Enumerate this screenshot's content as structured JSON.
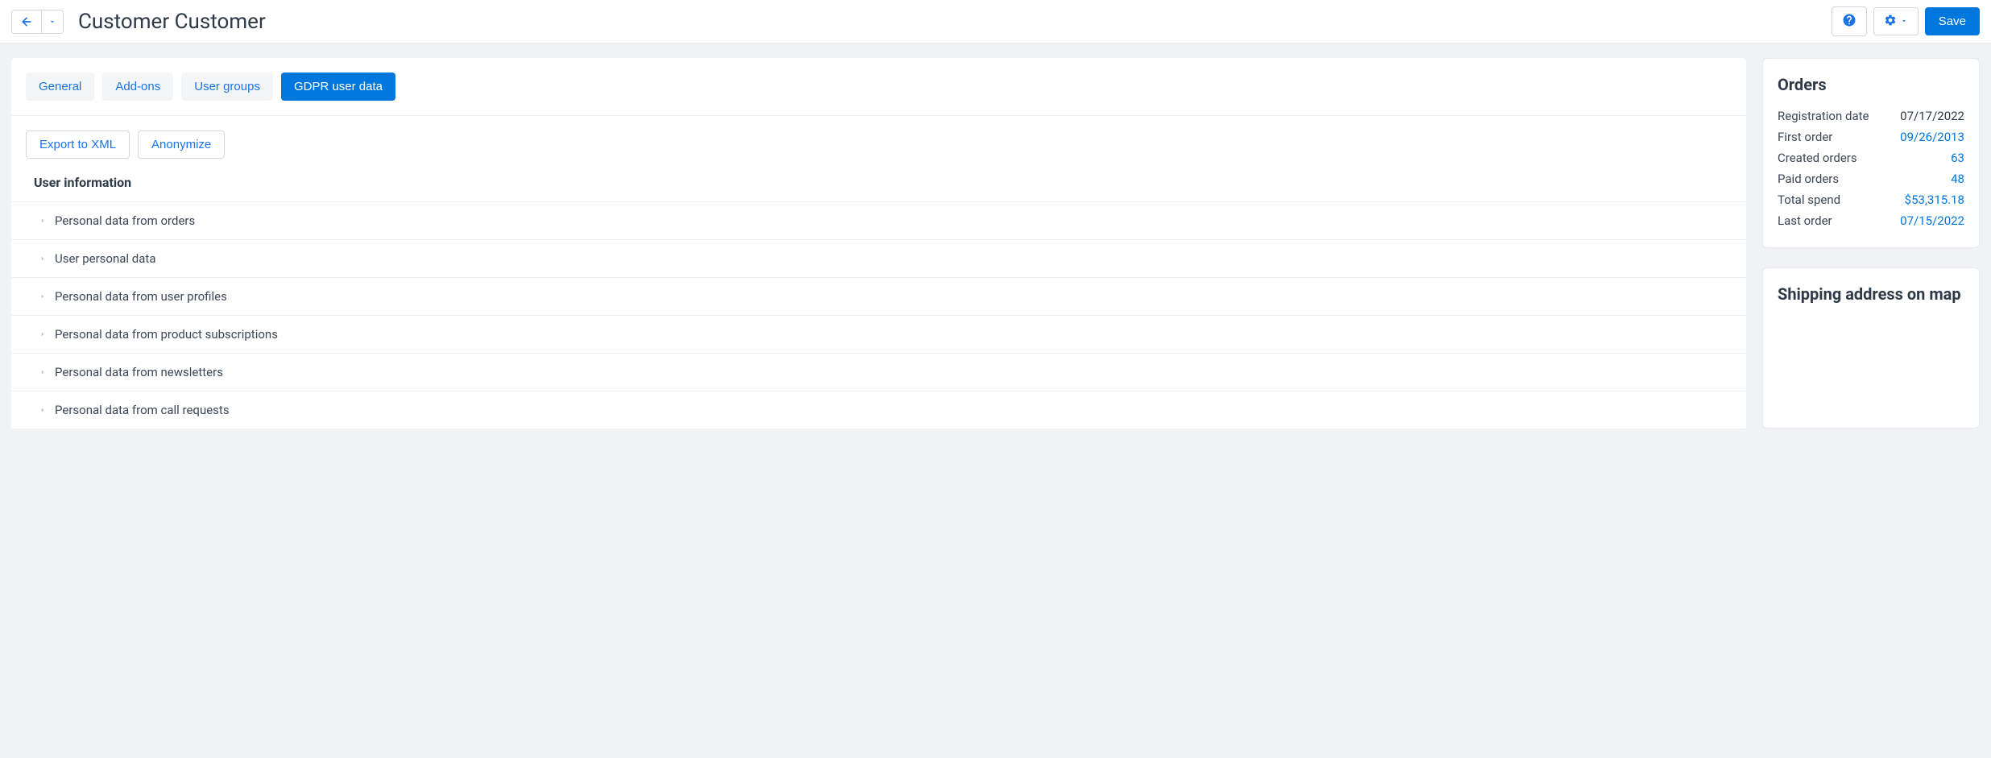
{
  "header": {
    "title": "Customer Customer",
    "save_label": "Save"
  },
  "tabs": [
    {
      "label": "General",
      "active": false
    },
    {
      "label": "Add-ons",
      "active": false
    },
    {
      "label": "User groups",
      "active": false
    },
    {
      "label": "GDPR user data",
      "active": true
    }
  ],
  "actions": {
    "export_label": "Export to XML",
    "anonymize_label": "Anonymize"
  },
  "section_title": "User information",
  "accordion_items": [
    "Personal data from orders",
    "User personal data",
    "Personal data from user profiles",
    "Personal data from product subscriptions",
    "Personal data from newsletters",
    "Personal data from call requests"
  ],
  "orders_panel": {
    "title": "Orders",
    "rows": [
      {
        "label": "Registration date",
        "value": "07/17/2022",
        "link": false
      },
      {
        "label": "First order",
        "value": "09/26/2013",
        "link": true
      },
      {
        "label": "Created orders",
        "value": "63",
        "link": true
      },
      {
        "label": "Paid orders",
        "value": "48",
        "link": true
      },
      {
        "label": "Total spend",
        "value": "$53,315.18",
        "link": true
      },
      {
        "label": "Last order",
        "value": "07/15/2022",
        "link": true
      }
    ]
  },
  "map_panel": {
    "title": "Shipping address on map"
  }
}
